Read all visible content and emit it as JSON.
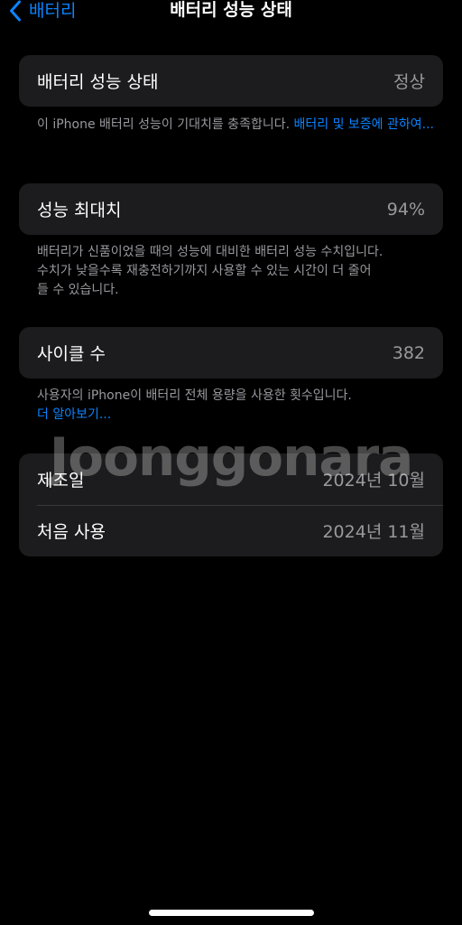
{
  "nav": {
    "back_label": "배터리",
    "title": "배터리 성능 상태"
  },
  "health": {
    "label": "배터리 성능 상태",
    "value": "정상",
    "footnote_text": "이 iPhone 배터리 성능이 기대치를 충족합니다. ",
    "footnote_link": "배터리 및 보증에 관하여..."
  },
  "max_capacity": {
    "label": "성능 최대치",
    "value": "94%",
    "footnote_line1": "배터리가 신품이었을 때의 성능에 대비한 배터리 성능 수치입니다.",
    "footnote_line2": "수치가 낮을수록 재충전하기까지 사용할 수 있는 시간이 더 줄어",
    "footnote_line3": "들 수 있습니다."
  },
  "cycle": {
    "label": "사이클 수",
    "value": "382",
    "footnote_text": "사용자의 iPhone이 배터리 전체 용량을 사용한 횟수입니다.",
    "footnote_link": "더 알아보기..."
  },
  "dates": {
    "manufacture_label": "제조일",
    "manufacture_value": "2024년 10월",
    "first_use_label": "처음 사용",
    "first_use_value": "2024년 11월"
  },
  "watermark": "Joonggonara",
  "colors": {
    "background": "#000000",
    "card": "#1c1c1e",
    "accent": "#0a84ff",
    "secondary_text": "#98989e"
  },
  "icons": {
    "back": "chevron-left-icon"
  }
}
